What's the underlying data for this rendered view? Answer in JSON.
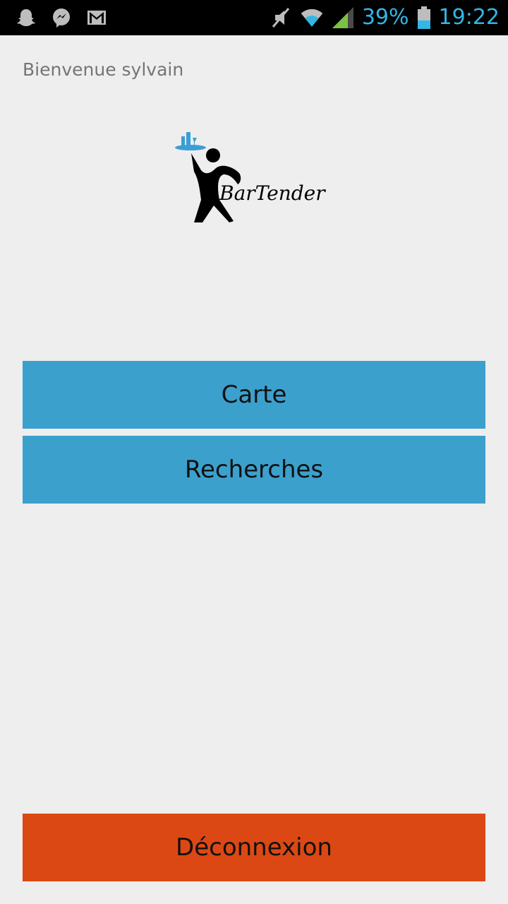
{
  "status_bar": {
    "battery_percent": "39%",
    "time": "19:22",
    "left_icons": [
      "snapchat-icon",
      "messenger-icon",
      "gmail-icon"
    ],
    "right_icons": [
      "mute-icon",
      "wifi-icon",
      "signal-icon",
      "battery-icon"
    ]
  },
  "welcome_text": "Bienvenue sylvain",
  "logo": {
    "text": "BarTender"
  },
  "buttons": {
    "carte": "Carte",
    "recherches": "Recherches",
    "deconnexion": "Déconnexion"
  },
  "colors": {
    "primary_button": "#3ca0cd",
    "logout_button": "#dc4814",
    "status_accent": "#33b5e5"
  }
}
